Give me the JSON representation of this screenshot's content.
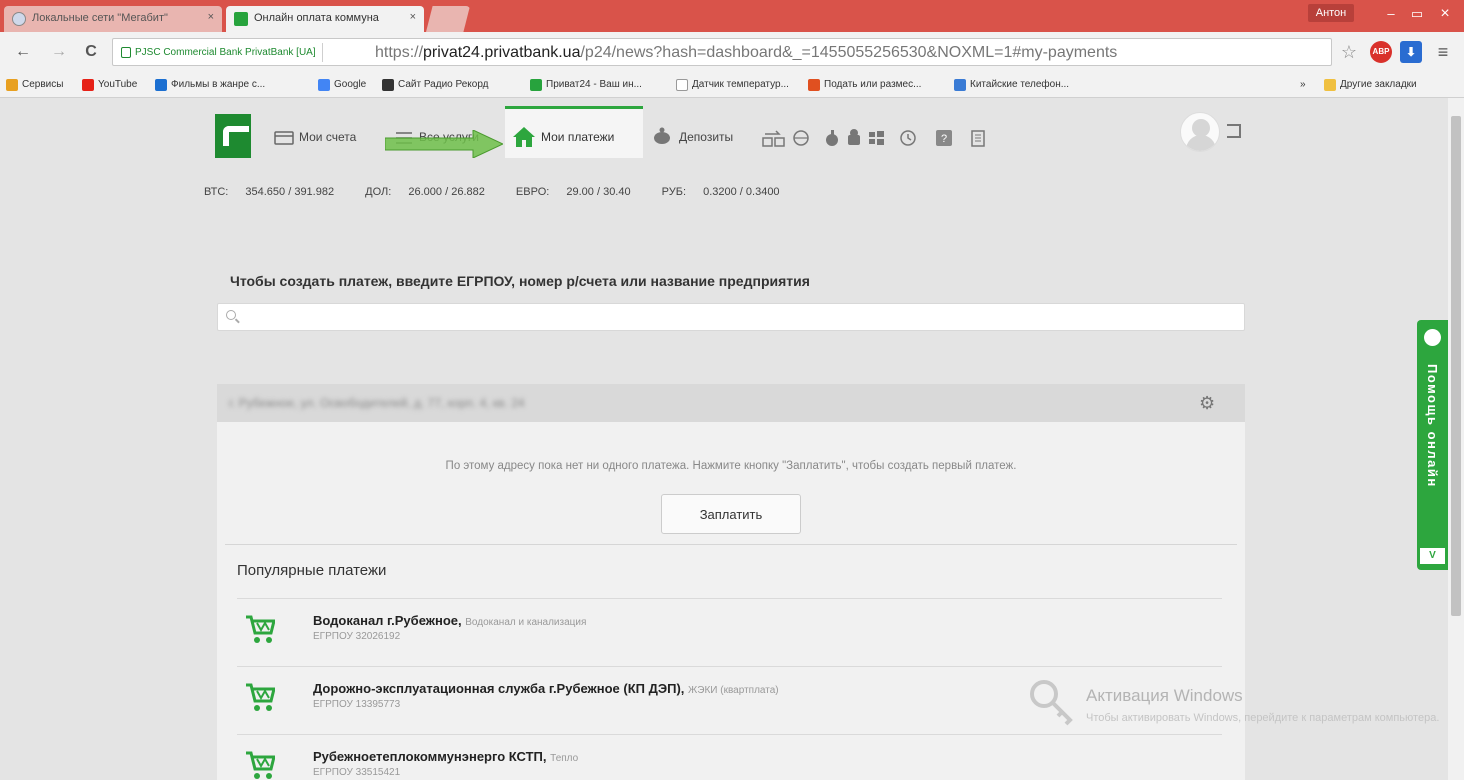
{
  "browser": {
    "tabs": [
      {
        "title": "Локальные сети \"Мегабит\"",
        "close": "×"
      },
      {
        "title": "Онлайн оплата коммуна",
        "close": "×"
      }
    ],
    "user": "Антон",
    "window_controls": {
      "minimize": "–",
      "maximize": "▭",
      "close": "×"
    },
    "nav": {
      "back": "←",
      "forward": "→",
      "reload": "C"
    },
    "security_label": "PJSC Commercial Bank PrivatBank [UA]",
    "url": {
      "scheme": "https://",
      "host": "privat24.privatbank.ua",
      "rest": "/p24/news?hash=dashboard&_=1455055256530&NOXML=1#my-payments"
    },
    "extensions": {
      "adblock": "ABP",
      "menu": "≡"
    },
    "bookmarks": [
      {
        "label": "Сервисы",
        "color": "#e8a020"
      },
      {
        "label": "YouTube",
        "color": "#e62117"
      },
      {
        "label": "Фильмы в жанре с...",
        "color": "#1b6fd1"
      },
      {
        "label": "Google",
        "color": "#4285f4"
      },
      {
        "label": "Сайт Радио Рекорд",
        "color": "#333333"
      },
      {
        "label": "Приват24 - Ваш ин...",
        "color": "#27a33d"
      },
      {
        "label": "Датчик температур...",
        "color": "#999999"
      },
      {
        "label": "Подать или размес...",
        "color": "#e05020"
      },
      {
        "label": "Китайские телефон...",
        "color": "#3a7bd5"
      }
    ],
    "bookmarks_more": "»",
    "other_bookmarks": "Другие закладки"
  },
  "site": {
    "nav": {
      "accounts": "Мои счета",
      "services": "Все услуги",
      "payments": "Мои платежи",
      "deposits": "Депозиты"
    },
    "rates": [
      {
        "label": "ВТС:",
        "value": "354.650 / 391.982"
      },
      {
        "label": "ДОЛ:",
        "value": "26.000 / 26.882"
      },
      {
        "label": "ЕВРО:",
        "value": "29.00 / 30.40"
      },
      {
        "label": "РУБ:",
        "value": "0.3200 / 0.3400"
      }
    ],
    "prompt": "Чтобы создать платеж, введите ЕГРПОУ, номер р/счета или название предприятия",
    "search_value": "",
    "address": "г. Рубежное, ул. Освободителей, д. 77, корп. 4, кв. 24",
    "empty_message": "По этому адресу пока нет ни одного платежа. Нажмите кнопку \"Заплатить\", чтобы создать первый платеж.",
    "pay_button": "Заплатить",
    "popular_title": "Популярные платежи",
    "popular": [
      {
        "name": "Водоканал г.Рубежное,",
        "category": "Водоканал и канализация",
        "code": "ЕГРПОУ 32026192"
      },
      {
        "name": "Дорожно-эксплуатационная служба г.Рубежное (КП ДЭП),",
        "category": "ЖЭКИ (квартплата)",
        "code": "ЕГРПОУ 13395773"
      },
      {
        "name": "Рубежноетеплокоммунэнерго КСТП,",
        "category": "Тепло",
        "code": "ЕГРПОУ 33515421"
      }
    ],
    "help": {
      "label": "Помощь онлайн",
      "toggle": "V"
    }
  },
  "watermark": {
    "title": "Активация Windows",
    "subtitle": "Чтобы активировать Windows, перейдите к параметрам компьютера."
  },
  "colors": {
    "brand_green": "#2da63e",
    "chrome_red": "#d9534a"
  }
}
